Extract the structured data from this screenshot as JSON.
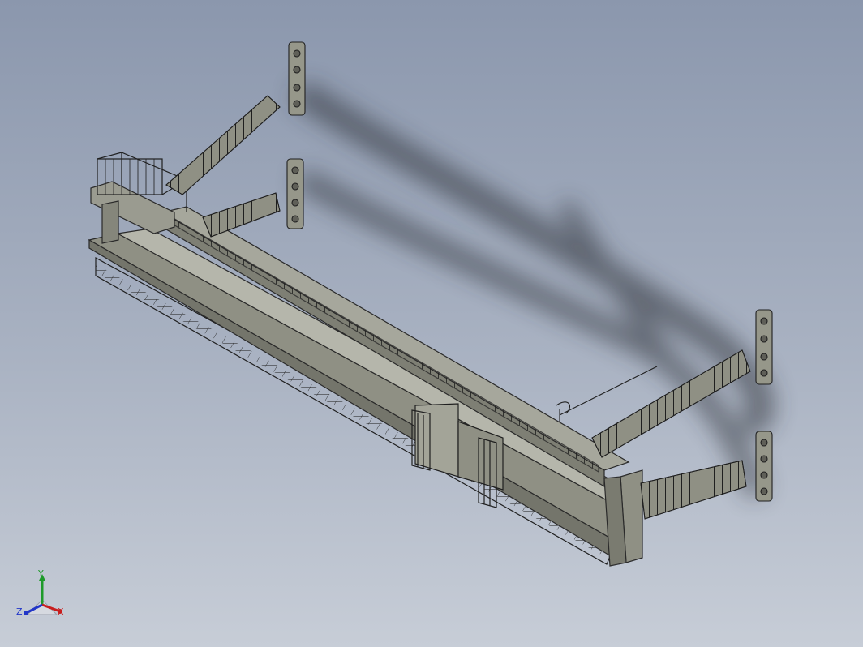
{
  "view": {
    "background_top": "#8b97ad",
    "background_bottom": "#c7cdd7",
    "model_fill": "#96978a",
    "model_edge": "#2a2a2a",
    "shadow_color": "#2c2f36"
  },
  "triad": {
    "x_label": "X",
    "y_label": "Y",
    "z_label": "Z",
    "x_color": "#c81e1e",
    "y_color": "#1e9a2a",
    "z_color": "#2236c8"
  }
}
